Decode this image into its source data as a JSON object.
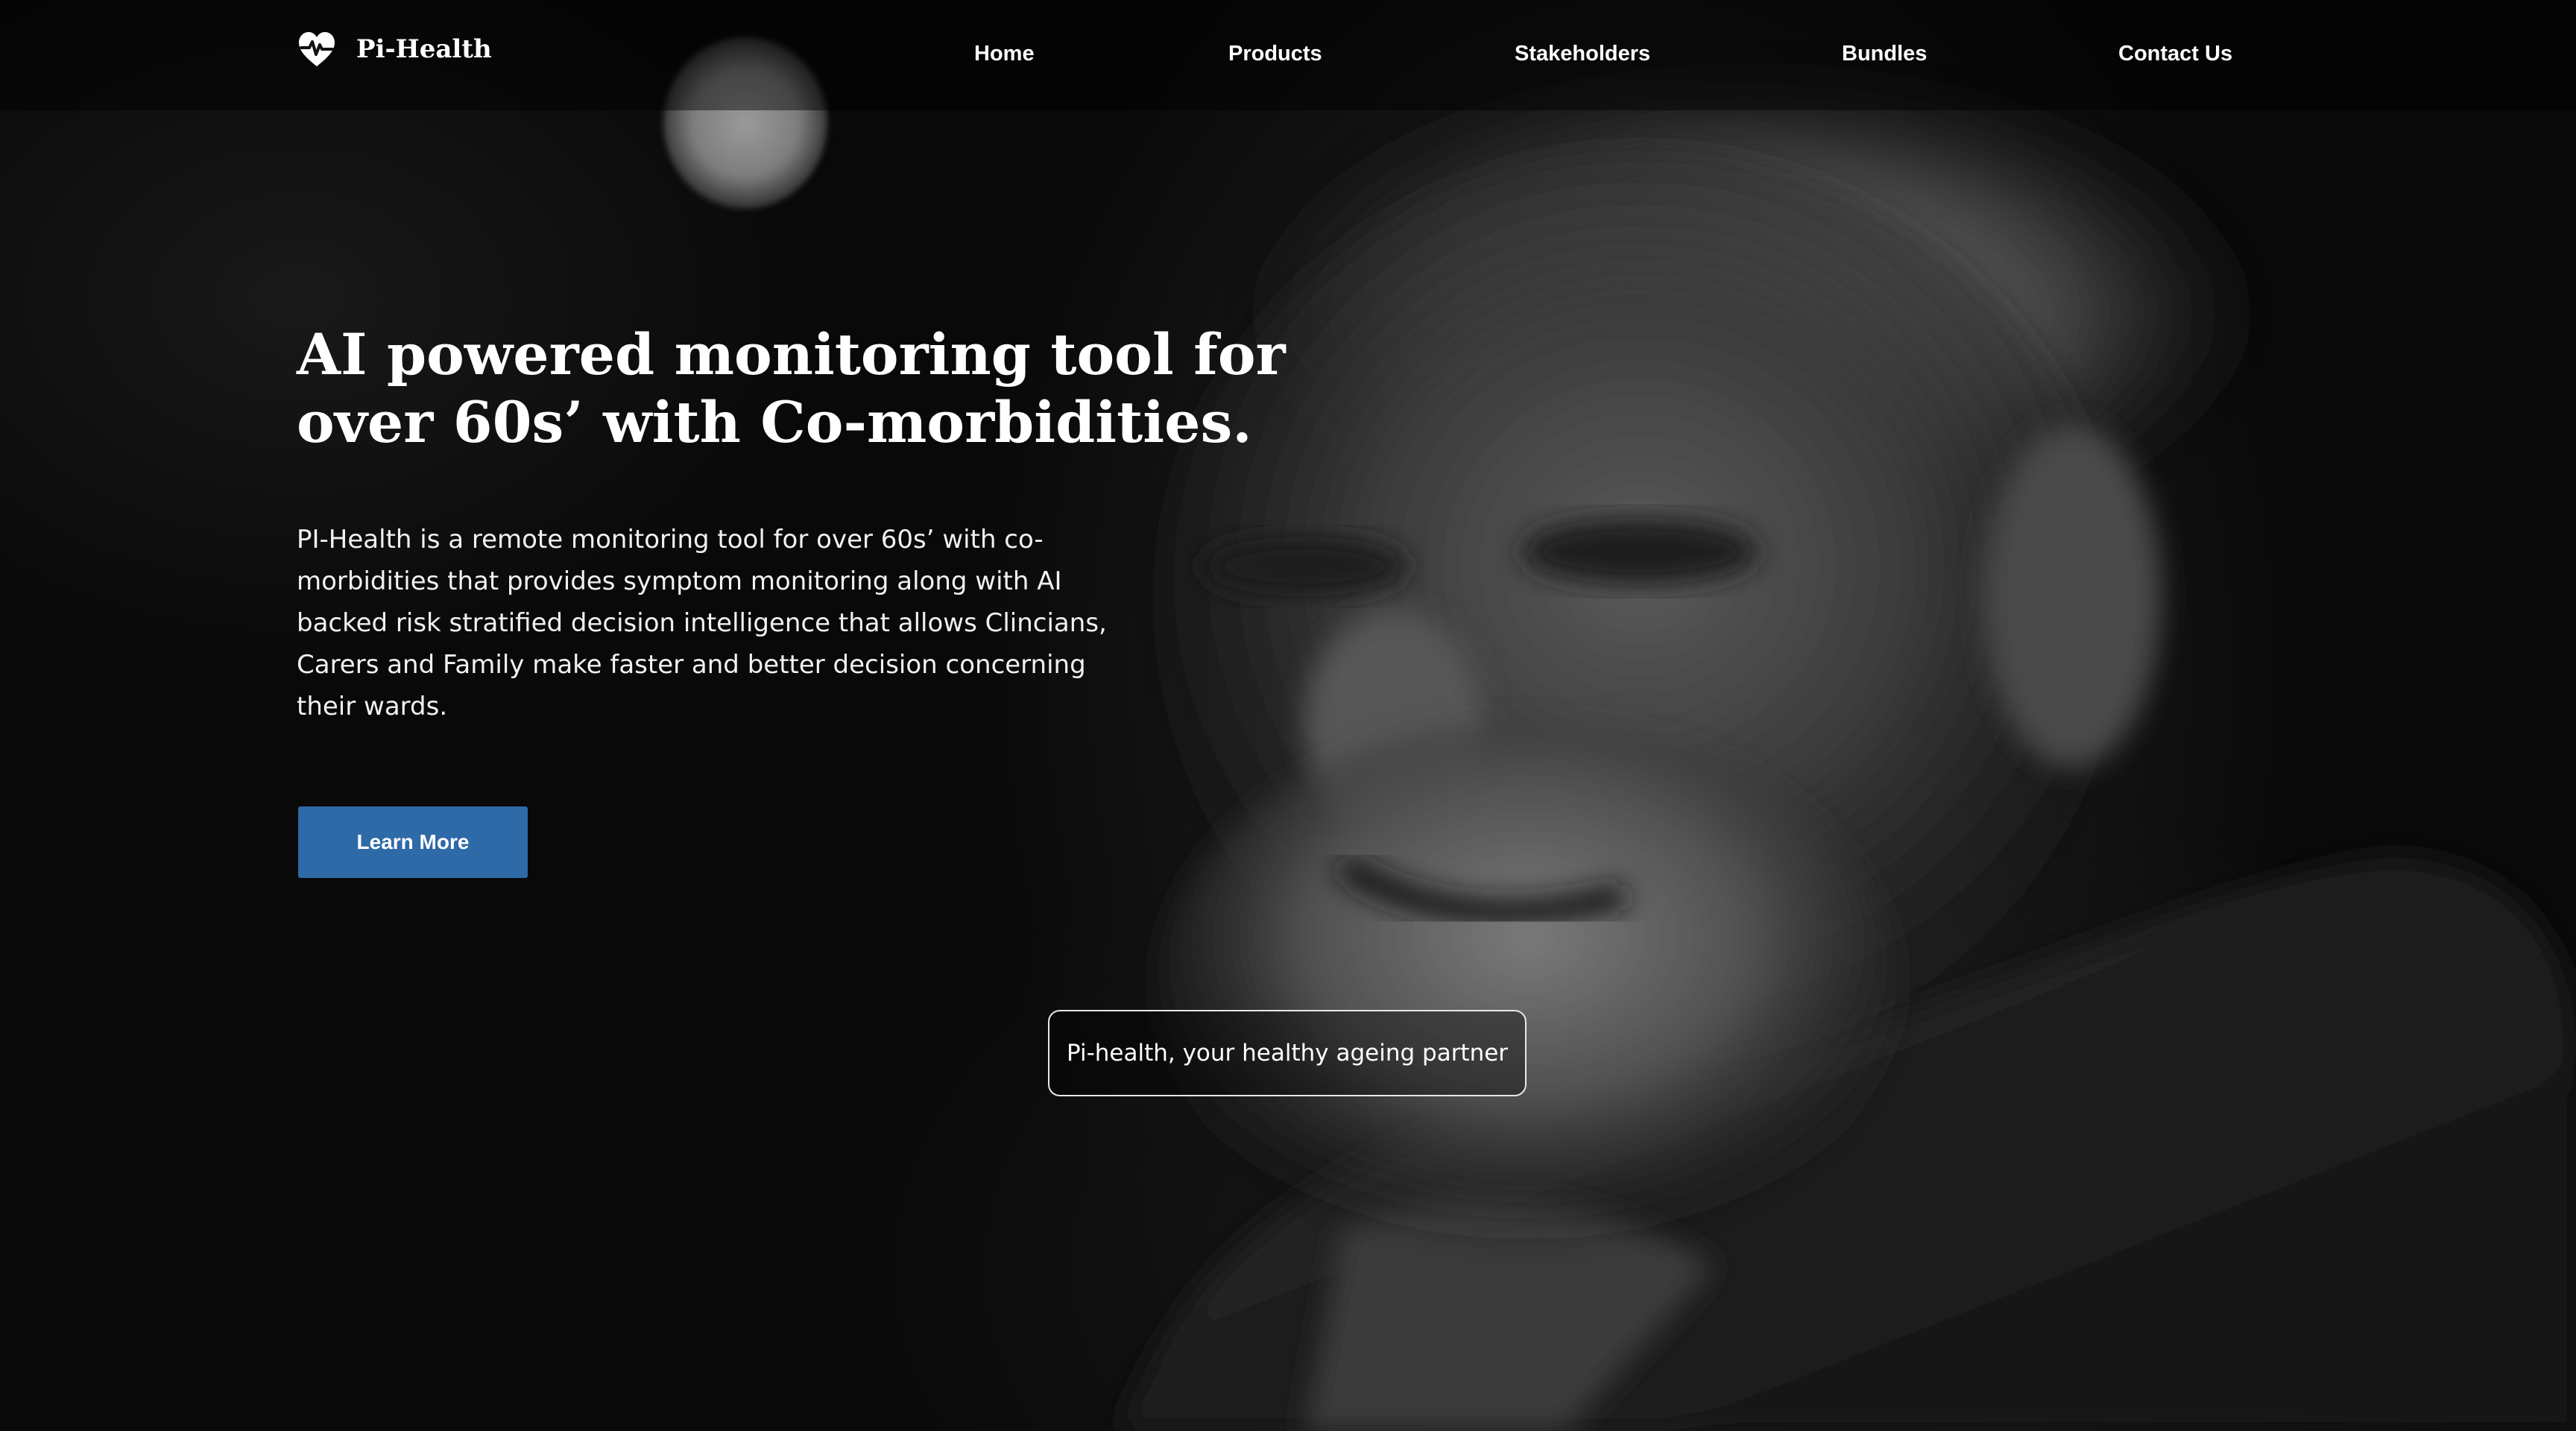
{
  "brand": {
    "name": "Pi-Health",
    "logo_icon": "heartbeat-heart-icon"
  },
  "nav": {
    "items": [
      {
        "label": "Home"
      },
      {
        "label": "Products"
      },
      {
        "label": "Stakeholders"
      },
      {
        "label": "Bundles"
      },
      {
        "label": "Contact Us"
      }
    ]
  },
  "hero": {
    "headline_line1": "AI powered monitoring tool for",
    "headline_line2": "over 60s’ with Co-morbidities.",
    "description": "PI-Health is a remote monitoring tool for over 60s’ with co-morbidities that provides symptom monitoring along with AI backed risk stratified decision intelligence that allows Clincians, Carers and Family make faster and better decision concerning their wards.",
    "cta_label": "Learn More",
    "tagline": "Pi-health, your healthy ageing partner",
    "background_image": "black-and-white portrait of smiling elderly bearded man"
  },
  "colors": {
    "cta_background": "#2f6aa8",
    "text": "#ffffff",
    "page_background": "#070707"
  }
}
